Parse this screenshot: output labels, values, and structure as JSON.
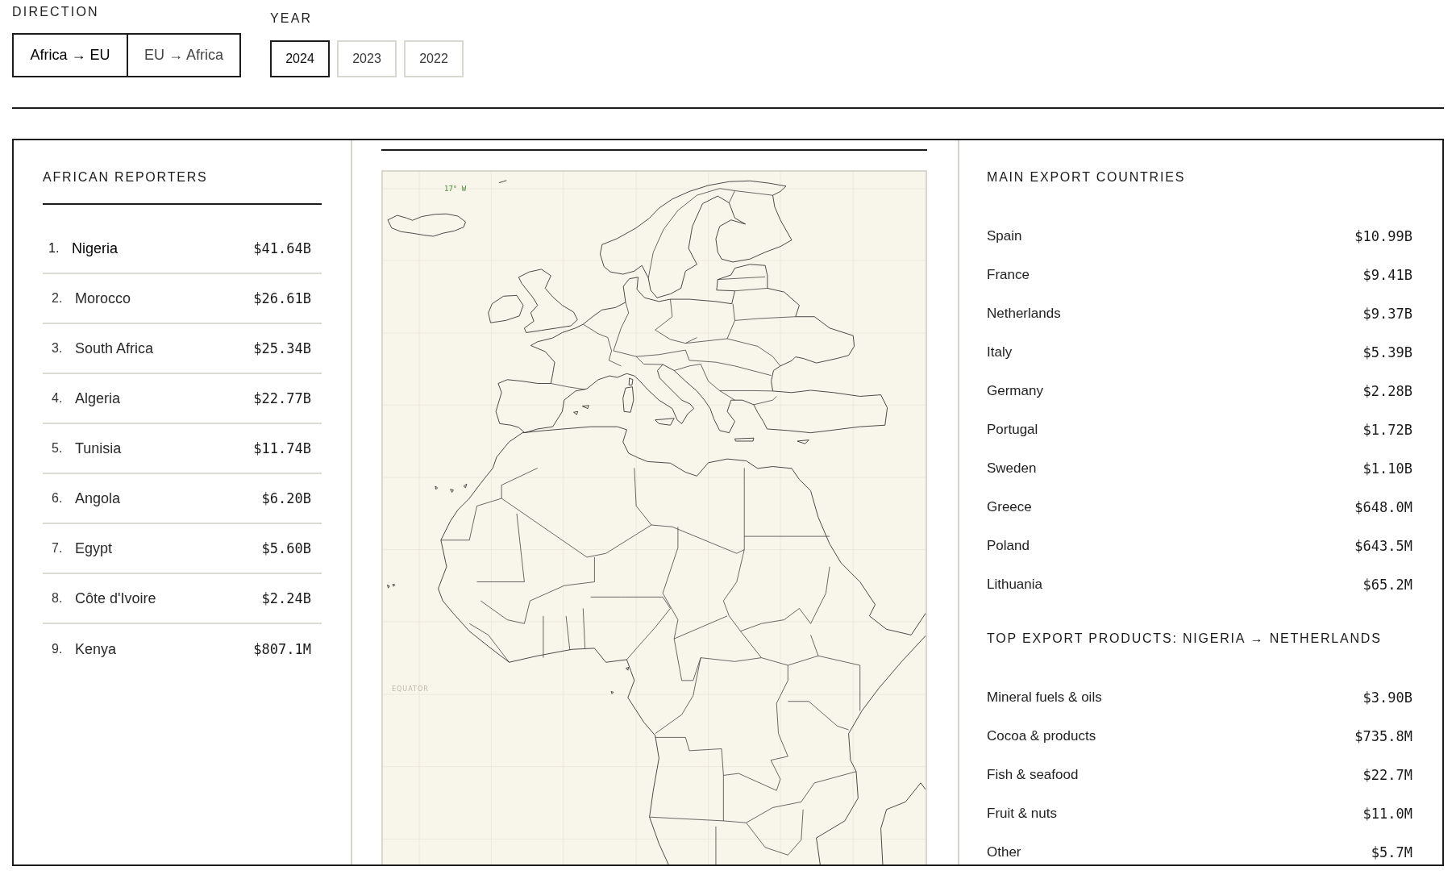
{
  "direction": {
    "label": "DIRECTION",
    "options": [
      {
        "label": "Africa → EU",
        "selected": true
      },
      {
        "label": "EU → Africa",
        "selected": false
      }
    ]
  },
  "year": {
    "label": "YEAR",
    "options": [
      {
        "label": "2024",
        "selected": true
      },
      {
        "label": "2023",
        "selected": false
      },
      {
        "label": "2022",
        "selected": false
      }
    ]
  },
  "reporters": {
    "title": "AFRICAN REPORTERS",
    "items": [
      {
        "rank": "1.",
        "name": "Nigeria",
        "value": "$41.64B",
        "selected": true
      },
      {
        "rank": "2.",
        "name": "Morocco",
        "value": "$26.61B",
        "selected": false
      },
      {
        "rank": "3.",
        "name": "South Africa",
        "value": "$25.34B",
        "selected": false
      },
      {
        "rank": "4.",
        "name": "Algeria",
        "value": "$22.77B",
        "selected": false
      },
      {
        "rank": "5.",
        "name": "Tunisia",
        "value": "$11.74B",
        "selected": false
      },
      {
        "rank": "6.",
        "name": "Angola",
        "value": "$6.20B",
        "selected": false
      },
      {
        "rank": "7.",
        "name": "Egypt",
        "value": "$5.60B",
        "selected": false
      },
      {
        "rank": "8.",
        "name": "Côte d'Ivoire",
        "value": "$2.24B",
        "selected": false
      },
      {
        "rank": "9.",
        "name": "Kenya",
        "value": "$807.1M",
        "selected": false
      }
    ]
  },
  "map": {
    "labels": [
      {
        "kind": "meridian",
        "text": "17° W"
      },
      {
        "kind": "parallel",
        "text": "EQUATOR"
      }
    ]
  },
  "export_countries": {
    "title": "MAIN EXPORT COUNTRIES",
    "items": [
      {
        "name": "Spain",
        "value": "$10.99B"
      },
      {
        "name": "France",
        "value": "$9.41B"
      },
      {
        "name": "Netherlands",
        "value": "$9.37B"
      },
      {
        "name": "Italy",
        "value": "$5.39B"
      },
      {
        "name": "Germany",
        "value": "$2.28B"
      },
      {
        "name": "Portugal",
        "value": "$1.72B"
      },
      {
        "name": "Sweden",
        "value": "$1.10B"
      },
      {
        "name": "Greece",
        "value": "$648.0M"
      },
      {
        "name": "Poland",
        "value": "$643.5M"
      },
      {
        "name": "Lithuania",
        "value": "$65.2M"
      }
    ]
  },
  "export_products": {
    "title": "TOP EXPORT PRODUCTS: NIGERIA → NETHERLANDS",
    "items": [
      {
        "name": "Mineral fuels & oils",
        "value": "$3.90B"
      },
      {
        "name": "Cocoa & products",
        "value": "$735.8M"
      },
      {
        "name": "Fish & seafood",
        "value": "$22.7M"
      },
      {
        "name": "Fruit & nuts",
        "value": "$11.0M"
      },
      {
        "name": "Other",
        "value": "$5.7M"
      }
    ]
  }
}
